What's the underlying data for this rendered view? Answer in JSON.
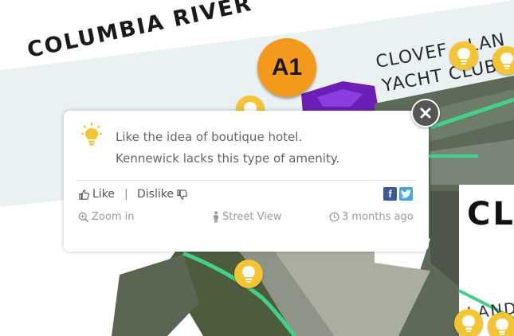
{
  "map": {
    "river_label": "COLUMBIA RIVER",
    "clover_label": "CLOVER ISLAND",
    "clover_visible": "CLOVEF",
    "clover_tail": "LAN",
    "yacht_label": "YACHT CLUB",
    "cl_label": "CL",
    "land_label": "LAND",
    "a1_label": "A1",
    "colors": {
      "water": "#e9f1f3",
      "marker": "#f39a1c",
      "pin": "#f5c431",
      "purple": "#6b1fb7",
      "green": "#3ed28a"
    }
  },
  "popup": {
    "icon": "lightbulb-icon",
    "comment_lines": [
      "Like the idea of boutique hotel.",
      "Kennewick lacks this type of amenity."
    ],
    "like_label": "Like",
    "separator": "|",
    "dislike_label": "Dislike",
    "zoom_label": "Zoom in",
    "street_view_label": "Street View",
    "time_label": "3 months ago",
    "share": {
      "facebook": "f",
      "twitter": "t"
    }
  }
}
